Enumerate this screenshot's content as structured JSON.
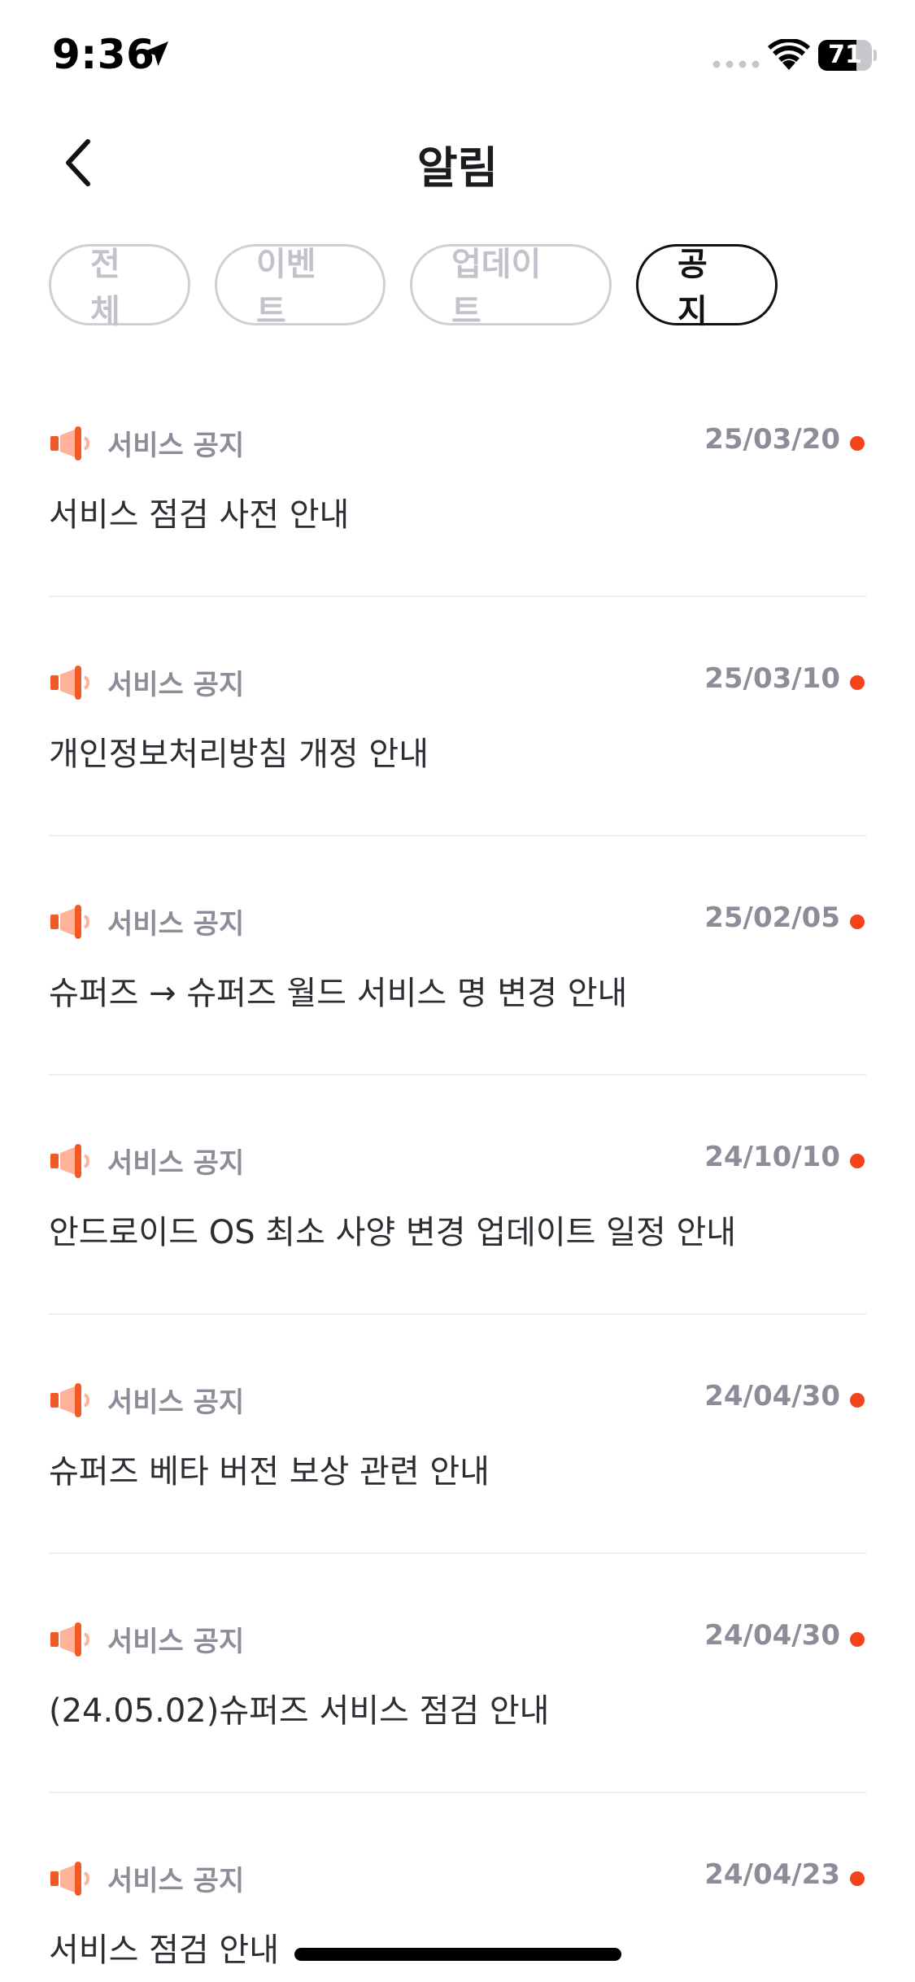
{
  "status_bar": {
    "time": "9:36",
    "battery_percent": "71",
    "battery_level": 0.71
  },
  "header": {
    "title": "알림"
  },
  "filters": [
    {
      "label": "전체",
      "active": false
    },
    {
      "label": "이벤트",
      "active": false
    },
    {
      "label": "업데이트",
      "active": false
    },
    {
      "label": "공지",
      "active": true
    }
  ],
  "notices": [
    {
      "category": "서비스 공지",
      "date": "25/03/20",
      "title": "서비스 점검 사전 안내",
      "unread": true
    },
    {
      "category": "서비스 공지",
      "date": "25/03/10",
      "title": "개인정보처리방침 개정 안내",
      "unread": true
    },
    {
      "category": "서비스 공지",
      "date": "25/02/05",
      "title": "슈퍼즈 → 슈퍼즈 월드 서비스 명 변경 안내",
      "unread": true
    },
    {
      "category": "서비스 공지",
      "date": "24/10/10",
      "title": "안드로이드 OS 최소 사양 변경 업데이트 일정 안내",
      "unread": true
    },
    {
      "category": "서비스 공지",
      "date": "24/04/30",
      "title": "슈퍼즈 베타 버전 보상 관련 안내",
      "unread": true
    },
    {
      "category": "서비스 공지",
      "date": "24/04/30",
      "title": "(24.05.02)슈퍼즈 서비스 점검 안내",
      "unread": true
    },
    {
      "category": "서비스 공지",
      "date": "24/04/23",
      "title": "서비스 점검 안내",
      "unread": true
    }
  ],
  "colors": {
    "accent_dot": "#f2431b",
    "megaphone": "#f15a24",
    "muted_text": "#8d8d99",
    "active_chip_border": "#111111",
    "inactive_chip_border": "#cfcfd6"
  },
  "icons": {
    "back": "chevron-left-icon",
    "megaphone": "megaphone-icon",
    "location": "location-arrow-icon",
    "wifi": "wifi-icon",
    "signal": "cellular-signal-icon"
  }
}
